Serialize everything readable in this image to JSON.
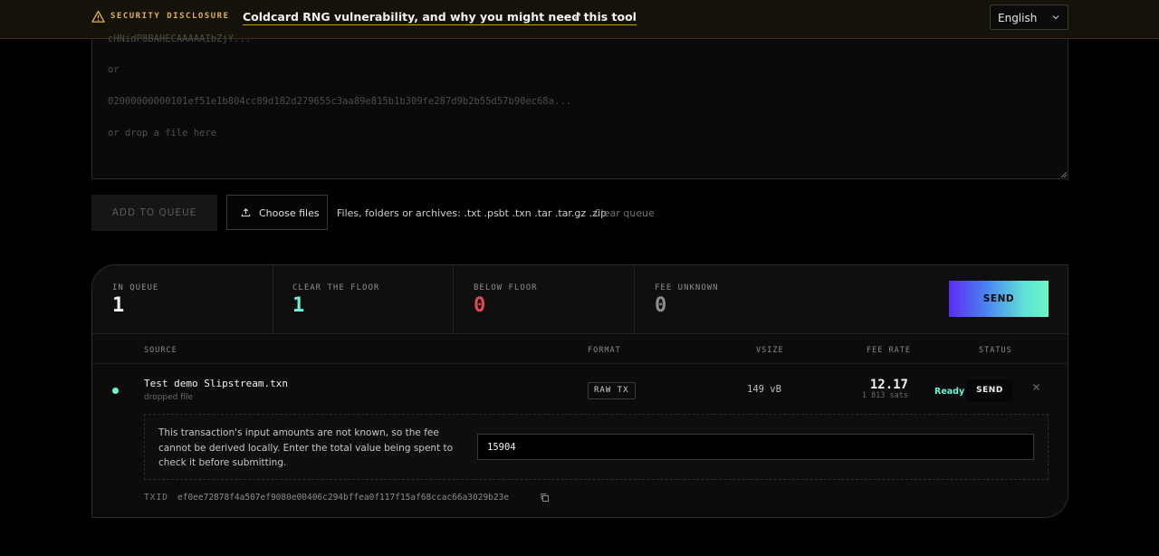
{
  "banner": {
    "tag": "SECURITY DISCLOSURE",
    "link_text": "Coldcard RNG vulnerability, and why you might need this tool",
    "external_glyph": "↗",
    "warn_icon": "warning-triangle-icon",
    "colors": {
      "tag": "#e0b34a",
      "underline": "#c99a2e"
    }
  },
  "language": {
    "selected": "English"
  },
  "input_area": {
    "lines": [
      "cHNidP8BAHECAAAAAIbZjY...",
      "or",
      "02000000000101ef51e1b804cc89d182d279655c3aa89e815b1b309fe287d9b2b55d57b90ec68a...",
      "or drop a file here"
    ]
  },
  "actions": {
    "add_to_queue": "ADD TO QUEUE",
    "choose_files": "Choose files",
    "hint": "Files, folders or archives: .txt .psbt .txn .tar .tar.gz .zip",
    "clear_queue": "Clear queue"
  },
  "stats": [
    {
      "label": "IN QUEUE",
      "value": "1",
      "color": "#f2f2f2"
    },
    {
      "label": "CLEAR THE FLOOR",
      "value": "1",
      "color": "#6ef2d8"
    },
    {
      "label": "BELOW FLOOR",
      "value": "0",
      "color": "#e5484d"
    },
    {
      "label": "FEE UNKNOWN",
      "value": "0",
      "color": "#8d8d8d"
    }
  ],
  "send_all_label": "SEND",
  "table": {
    "headers": {
      "source": "SOURCE",
      "format": "FORMAT",
      "vsize": "VSIZE",
      "fee_rate": "FEE RATE",
      "status": "STATUS"
    },
    "rows": [
      {
        "name": "Test demo Slipstream.txn",
        "origin": "dropped file",
        "format": "RAW TX",
        "vsize": "149 vB",
        "fee_rate": "12.17",
        "fee_sats": "1 813 sats",
        "status": "Ready",
        "send_label": "SEND",
        "remove_glyph": "×",
        "detail_message": "This transaction's input amounts are not known, so the fee cannot be derived locally. Enter the total value being spent to check it before submitting.",
        "input_value": "15904",
        "txid_label": "TXID",
        "txid": "ef0ee72878f4a507ef9080e00406c294bffea0f117f15af68ccac66a3029b23e"
      }
    ]
  }
}
